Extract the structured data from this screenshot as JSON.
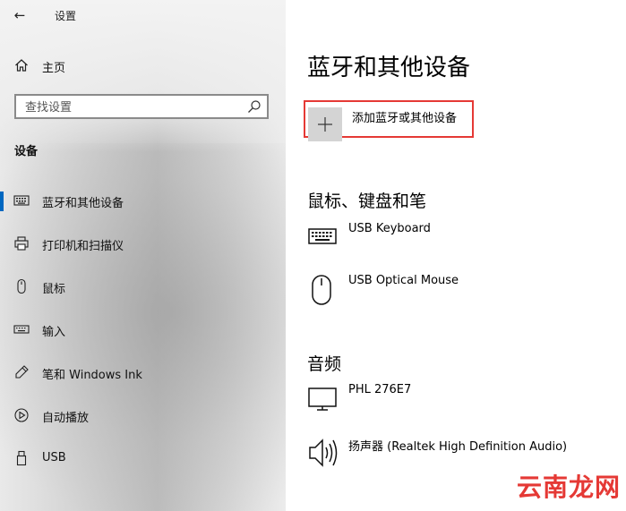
{
  "window": {
    "title": "设置",
    "back_label": "←"
  },
  "sidebar": {
    "home_label": "主页",
    "search_placeholder": "查找设置",
    "section_title": "设备",
    "items": [
      {
        "label": "蓝牙和其他设备",
        "icon": "bluetooth-keyboard-icon",
        "active": true
      },
      {
        "label": "打印机和扫描仪",
        "icon": "printer-icon",
        "active": false
      },
      {
        "label": "鼠标",
        "icon": "mouse-icon",
        "active": false
      },
      {
        "label": "输入",
        "icon": "keyboard-icon",
        "active": false
      },
      {
        "label": "笔和 Windows Ink",
        "icon": "pen-icon",
        "active": false
      },
      {
        "label": "自动播放",
        "icon": "autoplay-icon",
        "active": false
      },
      {
        "label": "USB",
        "icon": "usb-icon",
        "active": false
      }
    ]
  },
  "main": {
    "title": "蓝牙和其他设备",
    "add_device_label": "添加蓝牙或其他设备",
    "sections": [
      {
        "title": "鼠标、键盘和笔",
        "devices": [
          {
            "name": "USB Keyboard",
            "icon": "keyboard-icon"
          },
          {
            "name": "USB Optical Mouse",
            "icon": "mouse-icon"
          }
        ]
      },
      {
        "title": "音频",
        "devices": [
          {
            "name": "PHL 276E7",
            "icon": "monitor-icon"
          },
          {
            "name": "扬声器 (Realtek High Definition Audio)",
            "icon": "speaker-icon"
          }
        ]
      }
    ]
  },
  "watermark": "云南龙网",
  "colors": {
    "accent": "#0067c0",
    "highlight_border": "#e53935",
    "watermark": "#e53935"
  }
}
